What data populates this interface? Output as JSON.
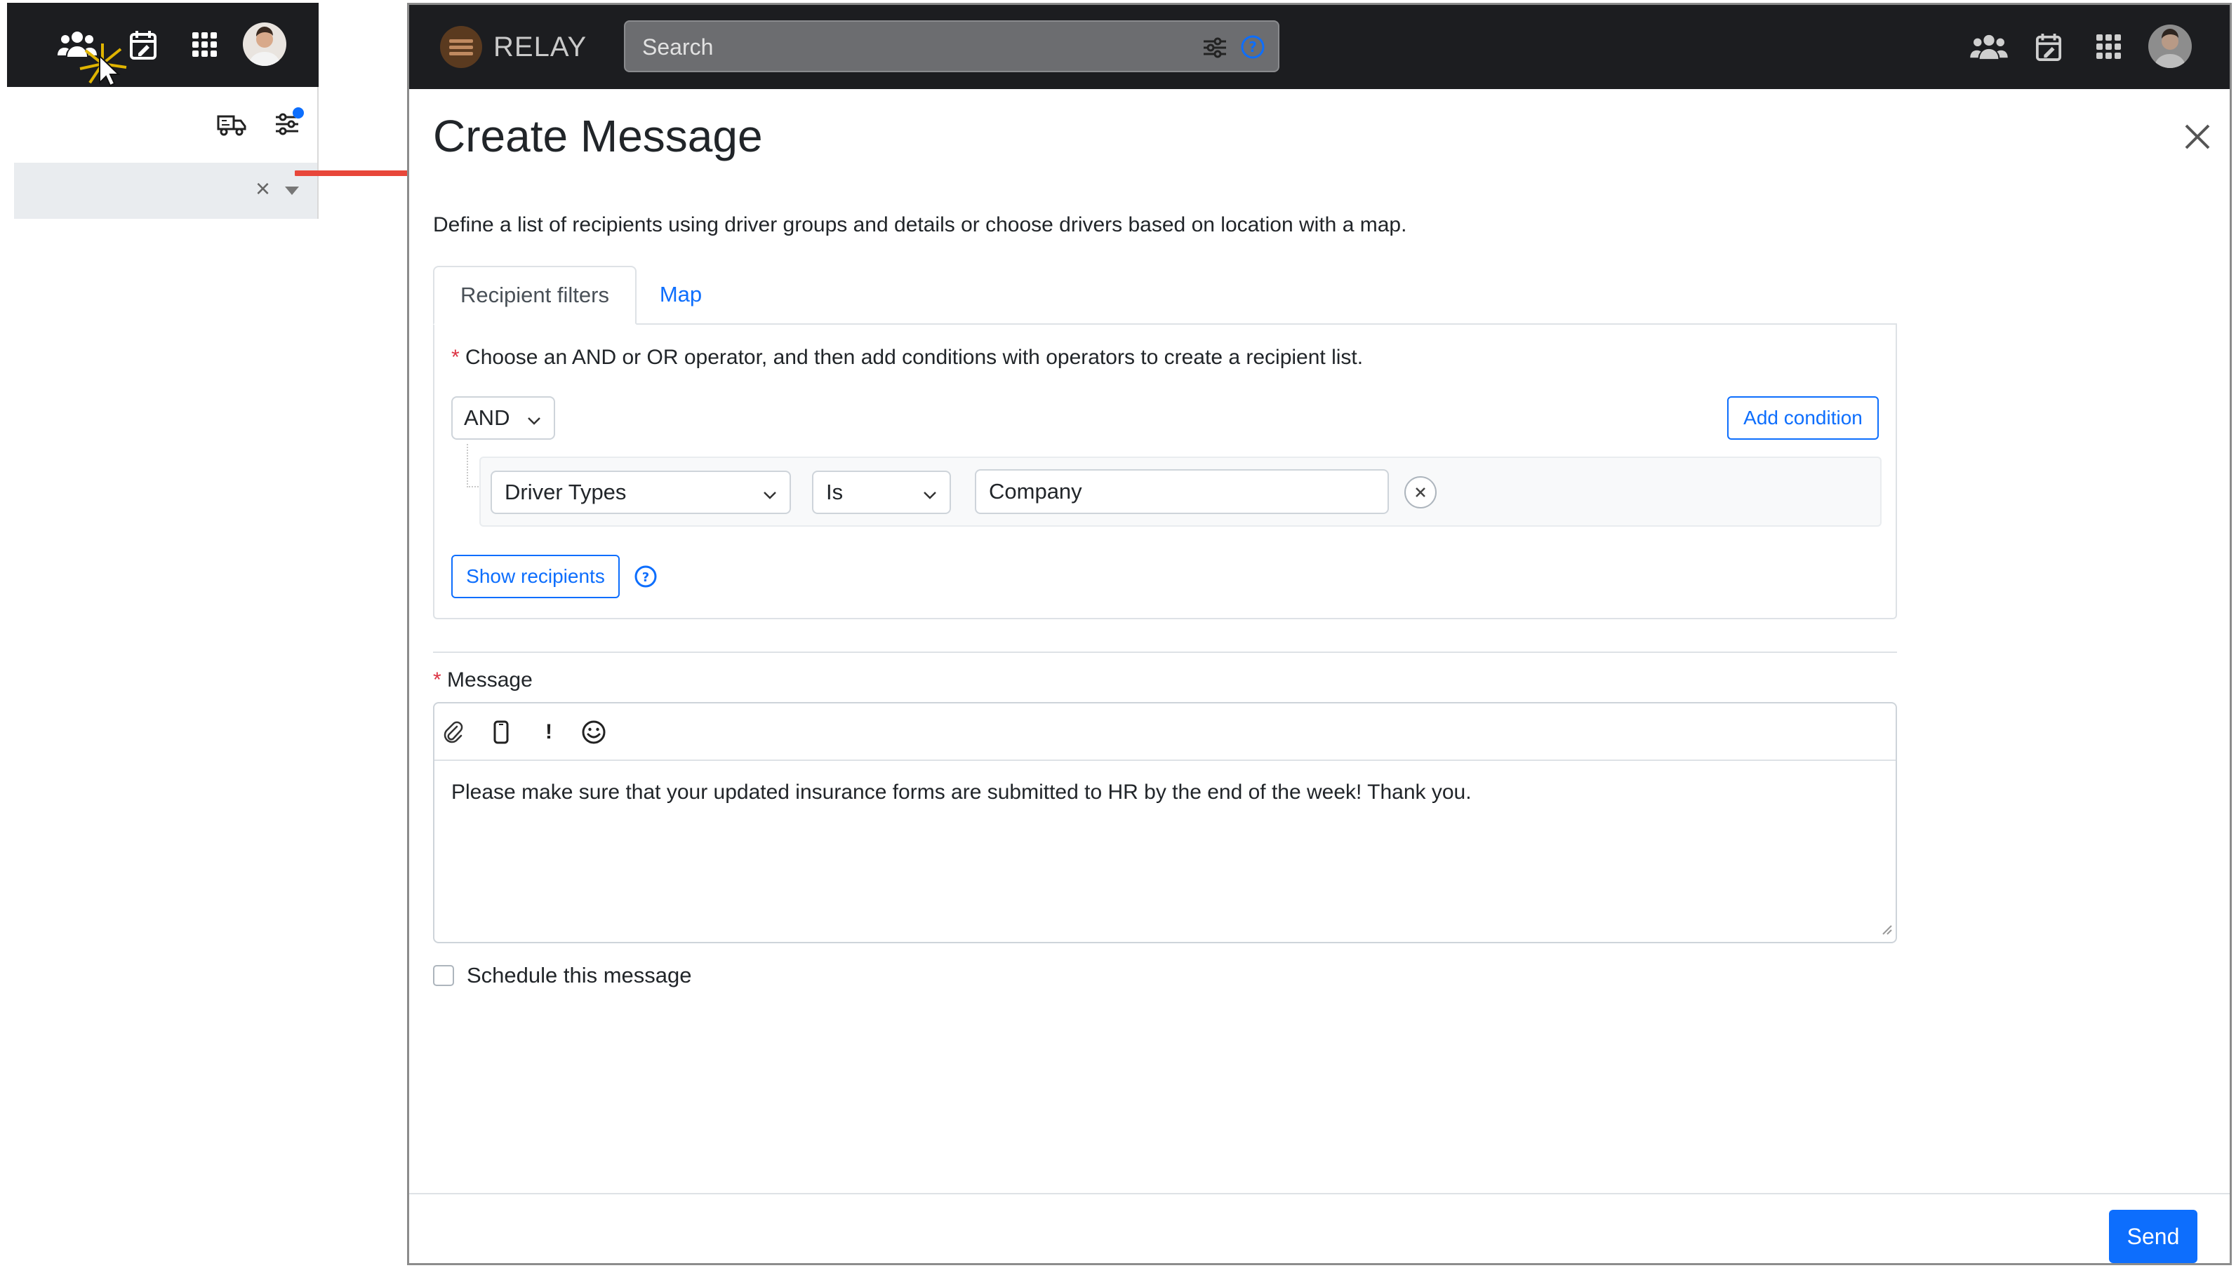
{
  "inset": {
    "close_glyph": "×"
  },
  "nav": {
    "brand": "RELAY",
    "search_placeholder": "Search"
  },
  "dialog": {
    "title": "Create Message",
    "description": "Define a list of recipients using driver groups and details or choose drivers based on location with a map.",
    "tabs": [
      {
        "label": "Recipient filters",
        "active": true
      },
      {
        "label": "Map",
        "active": false
      }
    ],
    "filter_instructions": "Choose an AND or OR operator, and then add conditions with operators to create a recipient list.",
    "required_marker": "*",
    "operator": "AND",
    "add_condition_label": "Add condition",
    "condition": {
      "field": "Driver Types",
      "comparator": "Is",
      "value": "Company"
    },
    "show_recipients_label": "Show recipients",
    "message_label": "Message",
    "toolbar": {
      "urgent_glyph": "!"
    },
    "message_text": "Please make sure that your updated insurance forms are submitted to HR by the end of the week! Thank you.",
    "schedule_label": "Schedule this message",
    "send_label": "Send"
  },
  "colors": {
    "nav_bg": "#1c1d20",
    "accent": "#0d6efd",
    "required": "#dc3545",
    "arrow": "#e8473a",
    "notification_dot": "#0d6efd"
  }
}
